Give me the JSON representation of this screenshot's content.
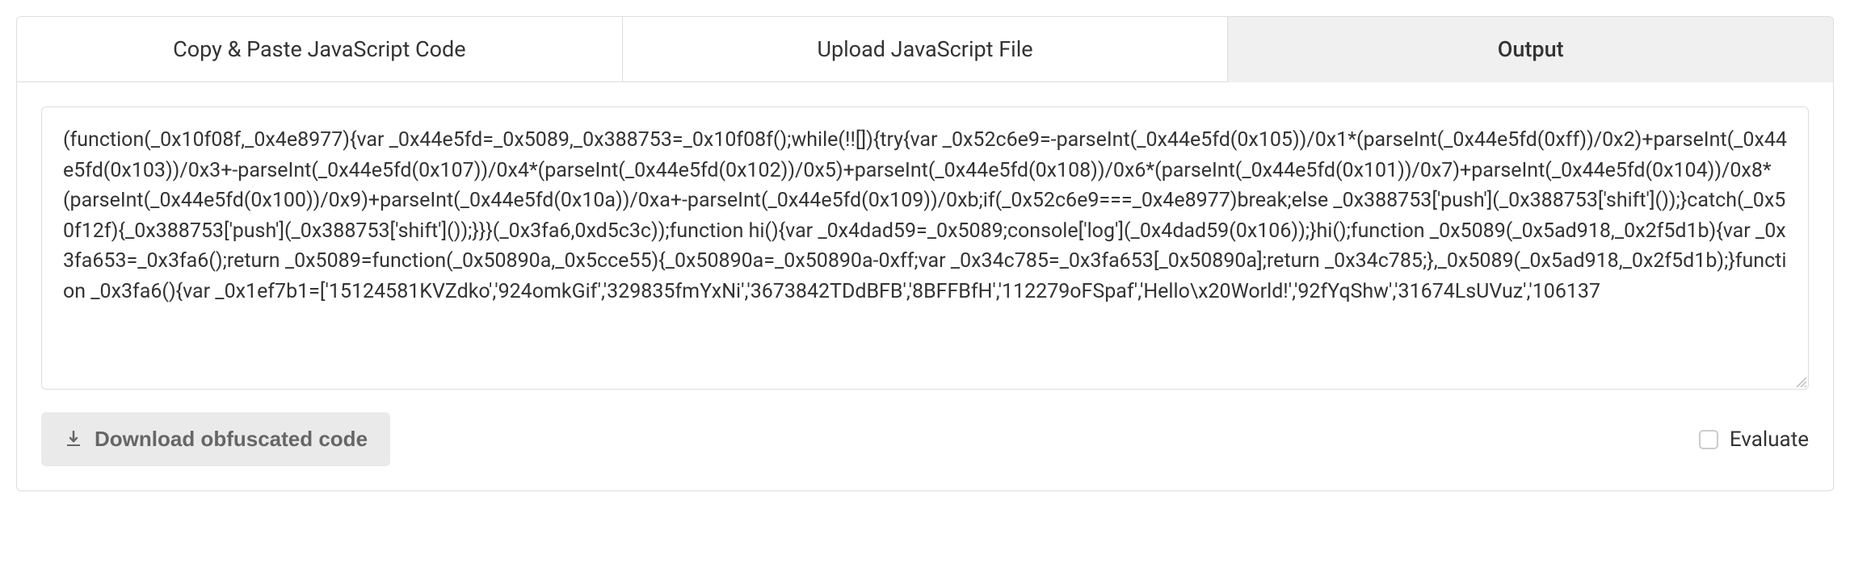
{
  "tabs": {
    "copy_paste": "Copy & Paste JavaScript Code",
    "upload": "Upload JavaScript File",
    "output": "Output"
  },
  "output_code": "(function(_0x10f08f,_0x4e8977){var _0x44e5fd=_0x5089,_0x388753=_0x10f08f();while(!![]){try{var _0x52c6e9=-parseInt(_0x44e5fd(0x105))/0x1*(parseInt(_0x44e5fd(0xff))/0x2)+parseInt(_0x44e5fd(0x103))/0x3+-parseInt(_0x44e5fd(0x107))/0x4*(parseInt(_0x44e5fd(0x102))/0x5)+parseInt(_0x44e5fd(0x108))/0x6*(parseInt(_0x44e5fd(0x101))/0x7)+parseInt(_0x44e5fd(0x104))/0x8*(parseInt(_0x44e5fd(0x100))/0x9)+parseInt(_0x44e5fd(0x10a))/0xa+-parseInt(_0x44e5fd(0x109))/0xb;if(_0x52c6e9===_0x4e8977)break;else _0x388753['push'](_0x388753['shift']());}catch(_0x50f12f){_0x388753['push'](_0x388753['shift']());}}}(_0x3fa6,0xd5c3c));function hi(){var _0x4dad59=_0x5089;console['log'](_0x4dad59(0x106));}hi();function _0x5089(_0x5ad918,_0x2f5d1b){var _0x3fa653=_0x3fa6();return _0x5089=function(_0x50890a,_0x5cce55){_0x50890a=_0x50890a-0xff;var _0x34c785=_0x3fa653[_0x50890a];return _0x34c785;},_0x5089(_0x5ad918,_0x2f5d1b);}function _0x3fa6(){var _0x1ef7b1=['15124581KVZdko','924omkGif','329835fmYxNi','3673842TDdBFB','8BFFBfH','112279oFSpaf','Hello\\x20World!','92fYqShw','31674LsUVuz','106137",
  "download_button": "Download obfuscated code",
  "evaluate_label": "Evaluate"
}
